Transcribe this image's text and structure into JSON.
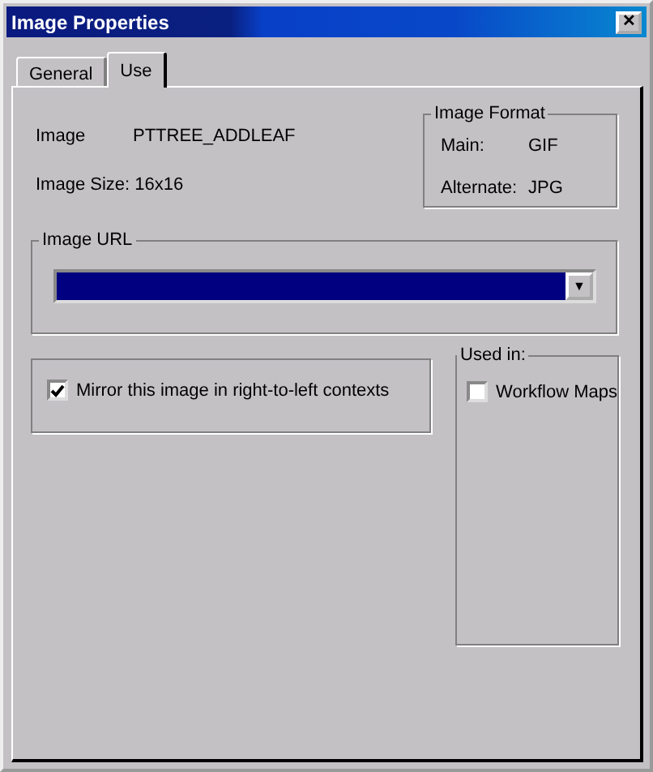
{
  "window": {
    "title": "Image Properties",
    "close": "✕"
  },
  "tabs": [
    {
      "label": "General",
      "selected": false
    },
    {
      "label": "Use",
      "selected": true
    }
  ],
  "image": {
    "label": "Image",
    "value": "PTTREE_ADDLEAF",
    "size_label": "Image Size:",
    "size_value": "16x16"
  },
  "image_format": {
    "title": "Image Format",
    "rows": [
      {
        "label": "Main:",
        "value": "GIF"
      },
      {
        "label": "Alternate:",
        "value": "JPG"
      }
    ]
  },
  "image_url": {
    "title": "Image URL",
    "arrow": "▼"
  },
  "mirror": {
    "label": "Mirror this image in right-to-left contexts",
    "checked": true
  },
  "used_in": {
    "title": "Used in:",
    "items": [
      {
        "label": "Workflow Maps",
        "checked": false
      }
    ]
  }
}
